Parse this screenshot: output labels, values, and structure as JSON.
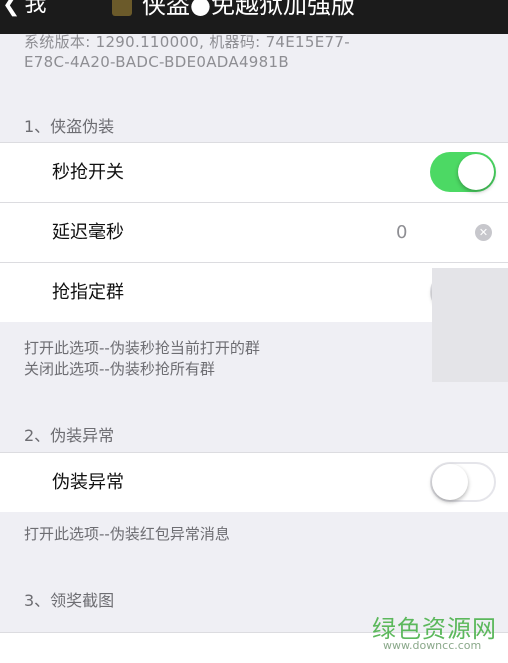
{
  "nav": {
    "back_label": "我",
    "title": "侠盗●免越狱加强版"
  },
  "sysinfo": {
    "line1": "系统版本: 1290.110000, 机器码: 74E15E77-",
    "line2": "E78C-4A20-BADC-BDE0ADA4981B"
  },
  "sections": [
    {
      "header": "1、侠盗伪装",
      "rows": [
        {
          "label": "秒抢开关",
          "type": "toggle",
          "state": "on"
        },
        {
          "label": "延迟毫秒",
          "type": "input",
          "value": "0"
        },
        {
          "label": "抢指定群",
          "type": "toggle",
          "state": "off"
        }
      ],
      "footer": [
        "打开此选项--伪装秒抢当前打开的群",
        "关闭此选项--伪装秒抢所有群"
      ]
    },
    {
      "header": "2、伪装异常",
      "rows": [
        {
          "label": "伪装异常",
          "type": "toggle",
          "state": "off"
        }
      ],
      "footer": [
        "打开此选项--伪装红包异常消息"
      ]
    },
    {
      "header": "3、领奖截图",
      "rows": [],
      "footer": []
    }
  ],
  "watermark": {
    "main": "绿色资源网",
    "url": "www.downcc.com"
  },
  "colors": {
    "toggle_on": "#4cd964",
    "background": "#efeff4",
    "navbar": "#1b1b1b",
    "watermark": "#5cb85c"
  }
}
